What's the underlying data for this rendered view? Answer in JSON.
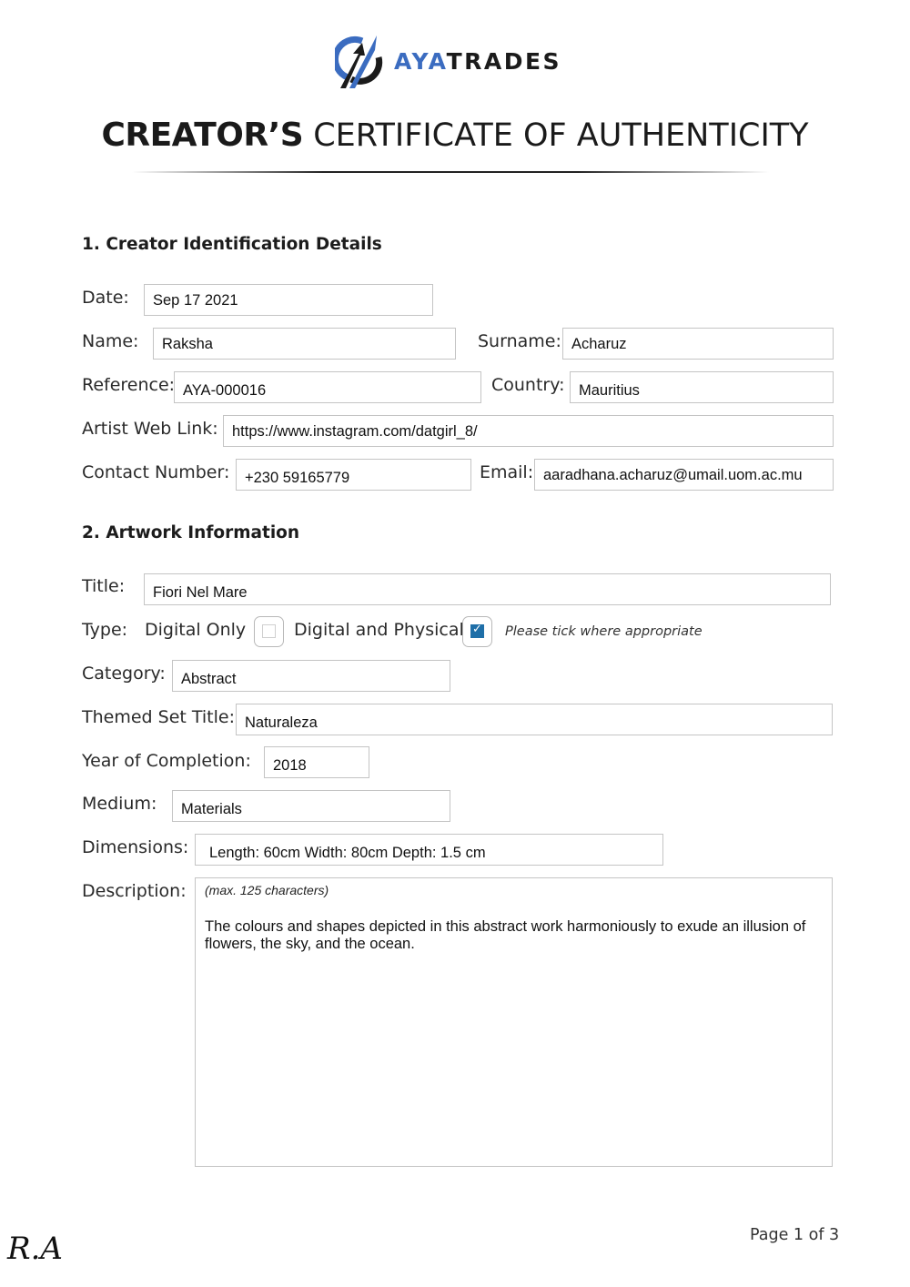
{
  "header": {
    "logo_icon": "ayatrades-logo-icon",
    "brand_prefix": "AYA",
    "brand_suffix": "TRADES",
    "title_bold": "CREATOR’S",
    "title_light": "CERTIFICATE OF AUTHENTICITY",
    "colors": {
      "brand_blue": "#3b6cc0",
      "brand_dark": "#1b1b1b",
      "checkbox_checked": "#1f6fa8"
    }
  },
  "section1": {
    "title": "1. Creator Identification Details",
    "date": {
      "label": "Date:",
      "value": "Sep 17 2021"
    },
    "name": {
      "label": "Name:",
      "value": "Raksha"
    },
    "surname": {
      "label": "Surname:",
      "value": "Acharuz"
    },
    "reference": {
      "label": "Reference:",
      "value": "AYA-000016"
    },
    "country": {
      "label": "Country:",
      "value": "Mauritius"
    },
    "web_link": {
      "label": "Artist Web Link:",
      "value": "https://www.instagram.com/datgirl_8/"
    },
    "contact": {
      "label": "Contact Number:",
      "value": "+230 59165779"
    },
    "email": {
      "label": "Email:",
      "value": "aaradhana.acharuz@umail.uom.ac.mu"
    }
  },
  "section2": {
    "title": "2. Artwork Information",
    "title_field": {
      "label": "Title:",
      "value": "Fiori Nel Mare"
    },
    "type": {
      "label": "Type:",
      "options": [
        {
          "label": "Digital Only",
          "checked": false
        },
        {
          "label": "Digital and Physical",
          "checked": true
        }
      ],
      "hint": "Please tick where appropriate",
      "check_glyph": "✓"
    },
    "category": {
      "label": "Category:",
      "value": "Abstract"
    },
    "themed_set": {
      "label": "Themed Set Title:",
      "value": "Naturaleza"
    },
    "year": {
      "label": "Year of Completion:",
      "value": "2018"
    },
    "medium": {
      "label": "Medium:",
      "value": "Materials"
    },
    "dimensions": {
      "label": "Dimensions:",
      "value": "Length: 60cm Width: 80cm Depth: 1.5 cm"
    },
    "description": {
      "label": "Description:",
      "hint": "(max. 125 characters)",
      "value": "The colours and shapes depicted in this abstract work harmoniously to exude an illusion of flowers, the sky, and the ocean."
    }
  },
  "footer": {
    "signature": "R.A",
    "page": "Page 1 of 3"
  }
}
